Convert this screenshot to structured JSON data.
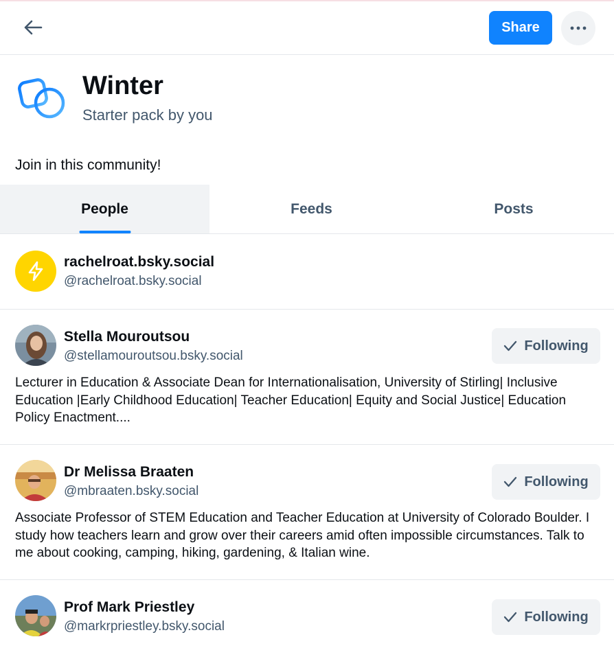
{
  "header": {
    "back_icon": "arrow-left-icon",
    "share_label": "Share",
    "more_icon": "ellipsis-icon",
    "accent_color": "#1083fe"
  },
  "pack": {
    "icon": "starter-pack-icon",
    "title": "Winter",
    "subtitle": "Starter pack by you",
    "description": "Join in this community!"
  },
  "tabs": [
    {
      "label": "People",
      "active": true
    },
    {
      "label": "Feeds",
      "active": false
    },
    {
      "label": "Posts",
      "active": false
    }
  ],
  "people": [
    {
      "name": "rachelroat.bsky.social",
      "handle": "@rachelroat.bsky.social",
      "avatar": "default-lightning-avatar",
      "bio": ""
    },
    {
      "name": "Stella Mouroutsou",
      "handle": "@stellamouroutsou.bsky.social",
      "avatar": "photo-avatar",
      "follow_label": "Following",
      "bio": "Lecturer in Education & Associate Dean for Internationalisation, University of Stirling| Inclusive Education |Early Childhood Education| Teacher Education| Equity and Social Justice| Education Policy Enactment...."
    },
    {
      "name": "Dr Melissa Braaten",
      "handle": "@mbraaten.bsky.social",
      "avatar": "photo-avatar",
      "follow_label": "Following",
      "bio": "Associate Professor of STEM Education and Teacher Education at University of Colorado Boulder. I study how teachers learn and grow over their careers amid often impossible circumstances. Talk to me about cooking, camping, hiking, gardening, & Italian wine."
    },
    {
      "name": "Prof Mark Priestley",
      "handle": "@markrpriestley.bsky.social",
      "avatar": "photo-avatar",
      "follow_label": "Following",
      "bio": ""
    }
  ]
}
